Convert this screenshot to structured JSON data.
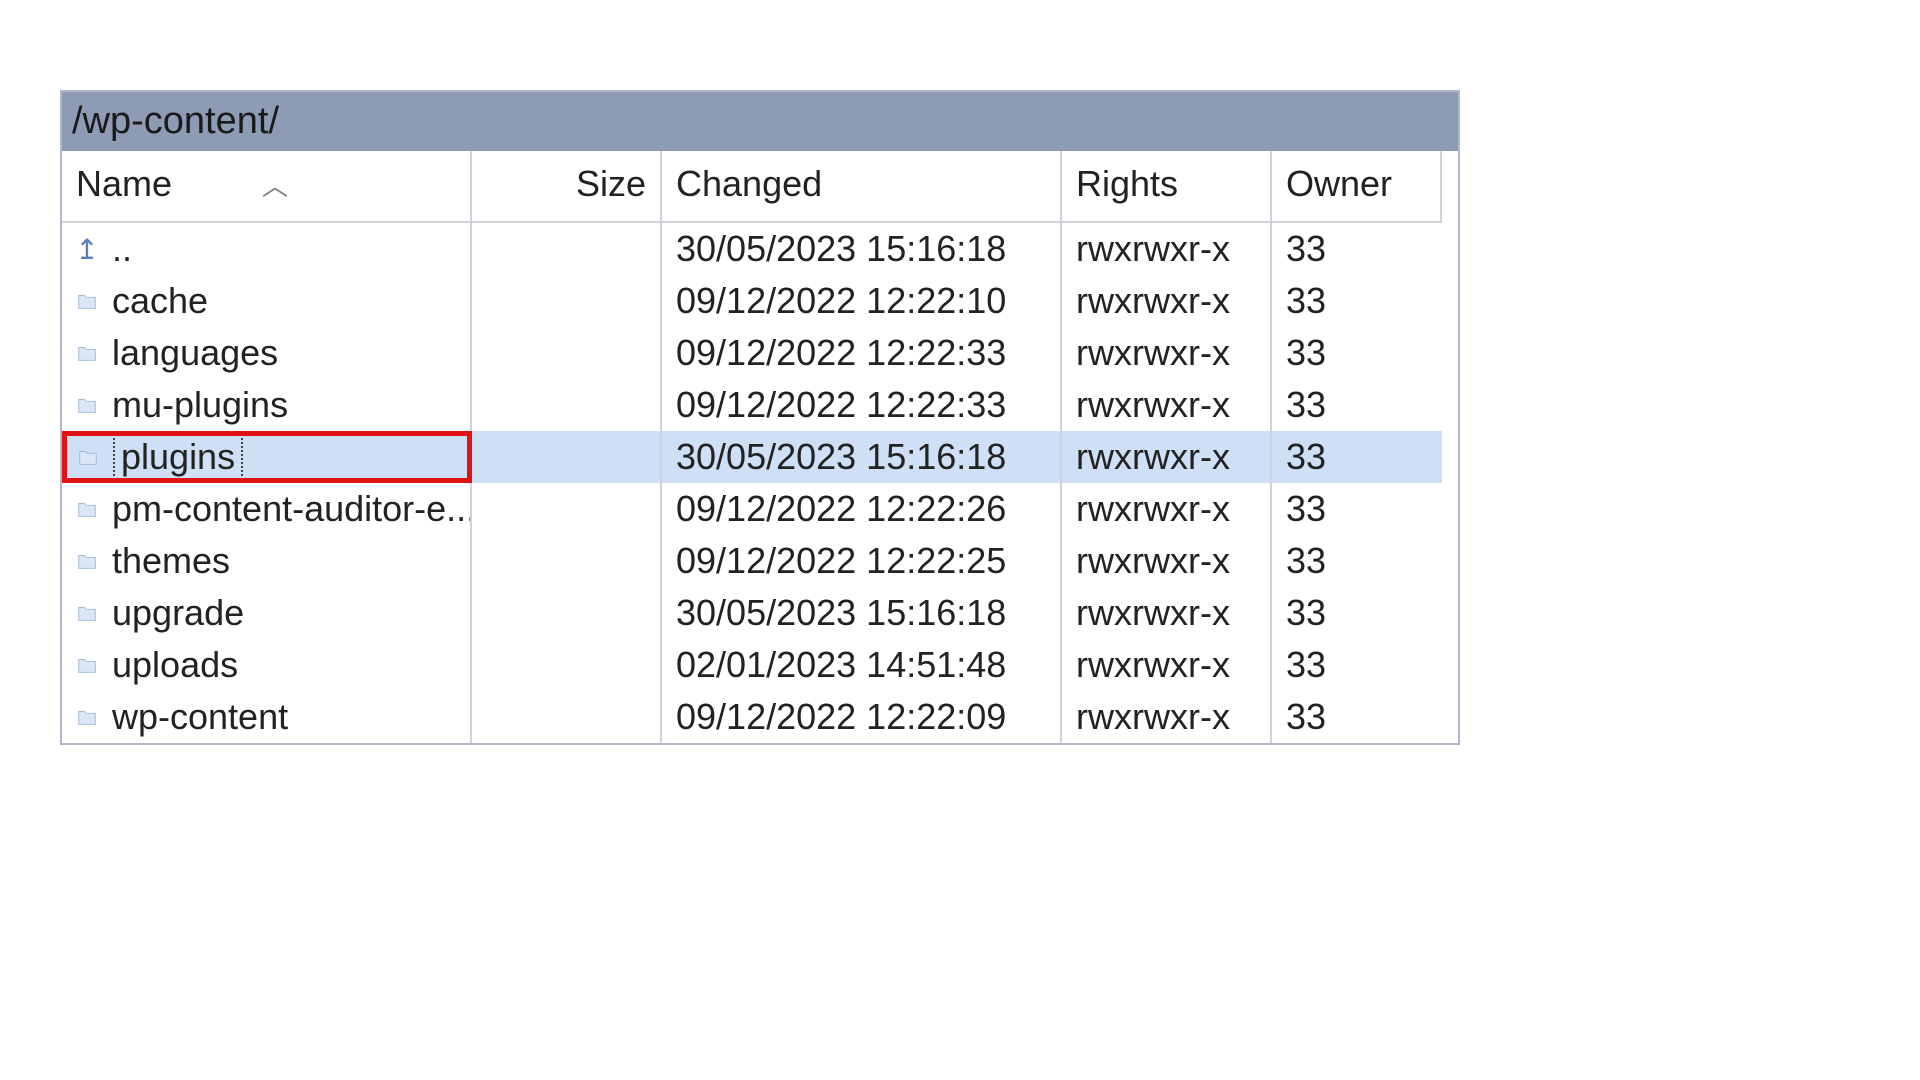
{
  "path": "/wp-content/",
  "columns": {
    "name": "Name",
    "size": "Size",
    "changed": "Changed",
    "rights": "Rights",
    "owner": "Owner"
  },
  "rows": [
    {
      "name": "..",
      "kind": "up",
      "size": "",
      "changed": "30/05/2023 15:16:18",
      "rights": "rwxrwxr-x",
      "owner": "33",
      "selected": false
    },
    {
      "name": "cache",
      "kind": "folder",
      "size": "",
      "changed": "09/12/2022 12:22:10",
      "rights": "rwxrwxr-x",
      "owner": "33",
      "selected": false
    },
    {
      "name": "languages",
      "kind": "folder",
      "size": "",
      "changed": "09/12/2022 12:22:33",
      "rights": "rwxrwxr-x",
      "owner": "33",
      "selected": false
    },
    {
      "name": "mu-plugins",
      "kind": "folder",
      "size": "",
      "changed": "09/12/2022 12:22:33",
      "rights": "rwxrwxr-x",
      "owner": "33",
      "selected": false
    },
    {
      "name": "plugins",
      "kind": "folder",
      "size": "",
      "changed": "30/05/2023 15:16:18",
      "rights": "rwxrwxr-x",
      "owner": "33",
      "selected": true
    },
    {
      "name": "pm-content-auditor-e...",
      "kind": "folder",
      "size": "",
      "changed": "09/12/2022 12:22:26",
      "rights": "rwxrwxr-x",
      "owner": "33",
      "selected": false
    },
    {
      "name": "themes",
      "kind": "folder",
      "size": "",
      "changed": "09/12/2022 12:22:25",
      "rights": "rwxrwxr-x",
      "owner": "33",
      "selected": false
    },
    {
      "name": "upgrade",
      "kind": "folder",
      "size": "",
      "changed": "30/05/2023 15:16:18",
      "rights": "rwxrwxr-x",
      "owner": "33",
      "selected": false
    },
    {
      "name": "uploads",
      "kind": "folder",
      "size": "",
      "changed": "02/01/2023 14:51:48",
      "rights": "rwxrwxr-x",
      "owner": "33",
      "selected": false
    },
    {
      "name": "wp-content",
      "kind": "folder",
      "size": "",
      "changed": "09/12/2022 12:22:09",
      "rights": "rwxrwxr-x",
      "owner": "33",
      "selected": false
    }
  ],
  "icons": {
    "folder_svg": "<svg viewBox='0 0 24 24'><path fill='#dbe6f7' stroke='#9fb5d8' stroke-width='1' d='M3 6 L9 6 L11 8 L21 8 L21 20 L3 20 Z'/></svg>",
    "up_glyph": "↥"
  }
}
